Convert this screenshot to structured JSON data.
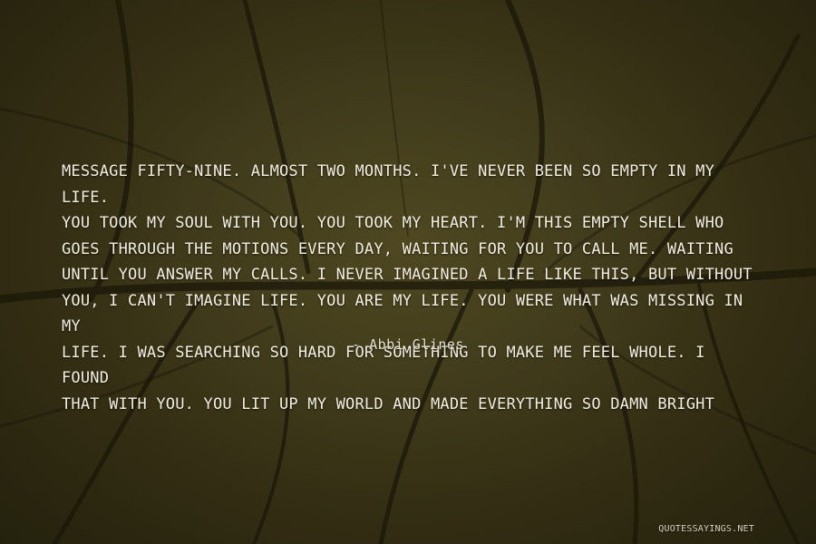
{
  "quote": {
    "text": "Message fifty-nine. Almost two months. I've never been so empty in my life.\nYou took my soul with you. You took my heart. I'm this empty shell who\ngoes through the motions every day, waiting for you to call me. Waiting\nuntil you answer my calls. I never imagined a life like this, but without\nyou, I can't imagine life. You are my life. You were what was missing in my\nlife. I was searching so hard for something to make me feel whole. I found\nthat with you. You lit up my world and made everything so damn bright",
    "author": "- Abbi Glines"
  },
  "watermark": "QUOTESSAYINGS.NET",
  "colors": {
    "text": "#f3eee0",
    "background": "#3a3416",
    "leaf_vein": "#1f1b0a"
  }
}
